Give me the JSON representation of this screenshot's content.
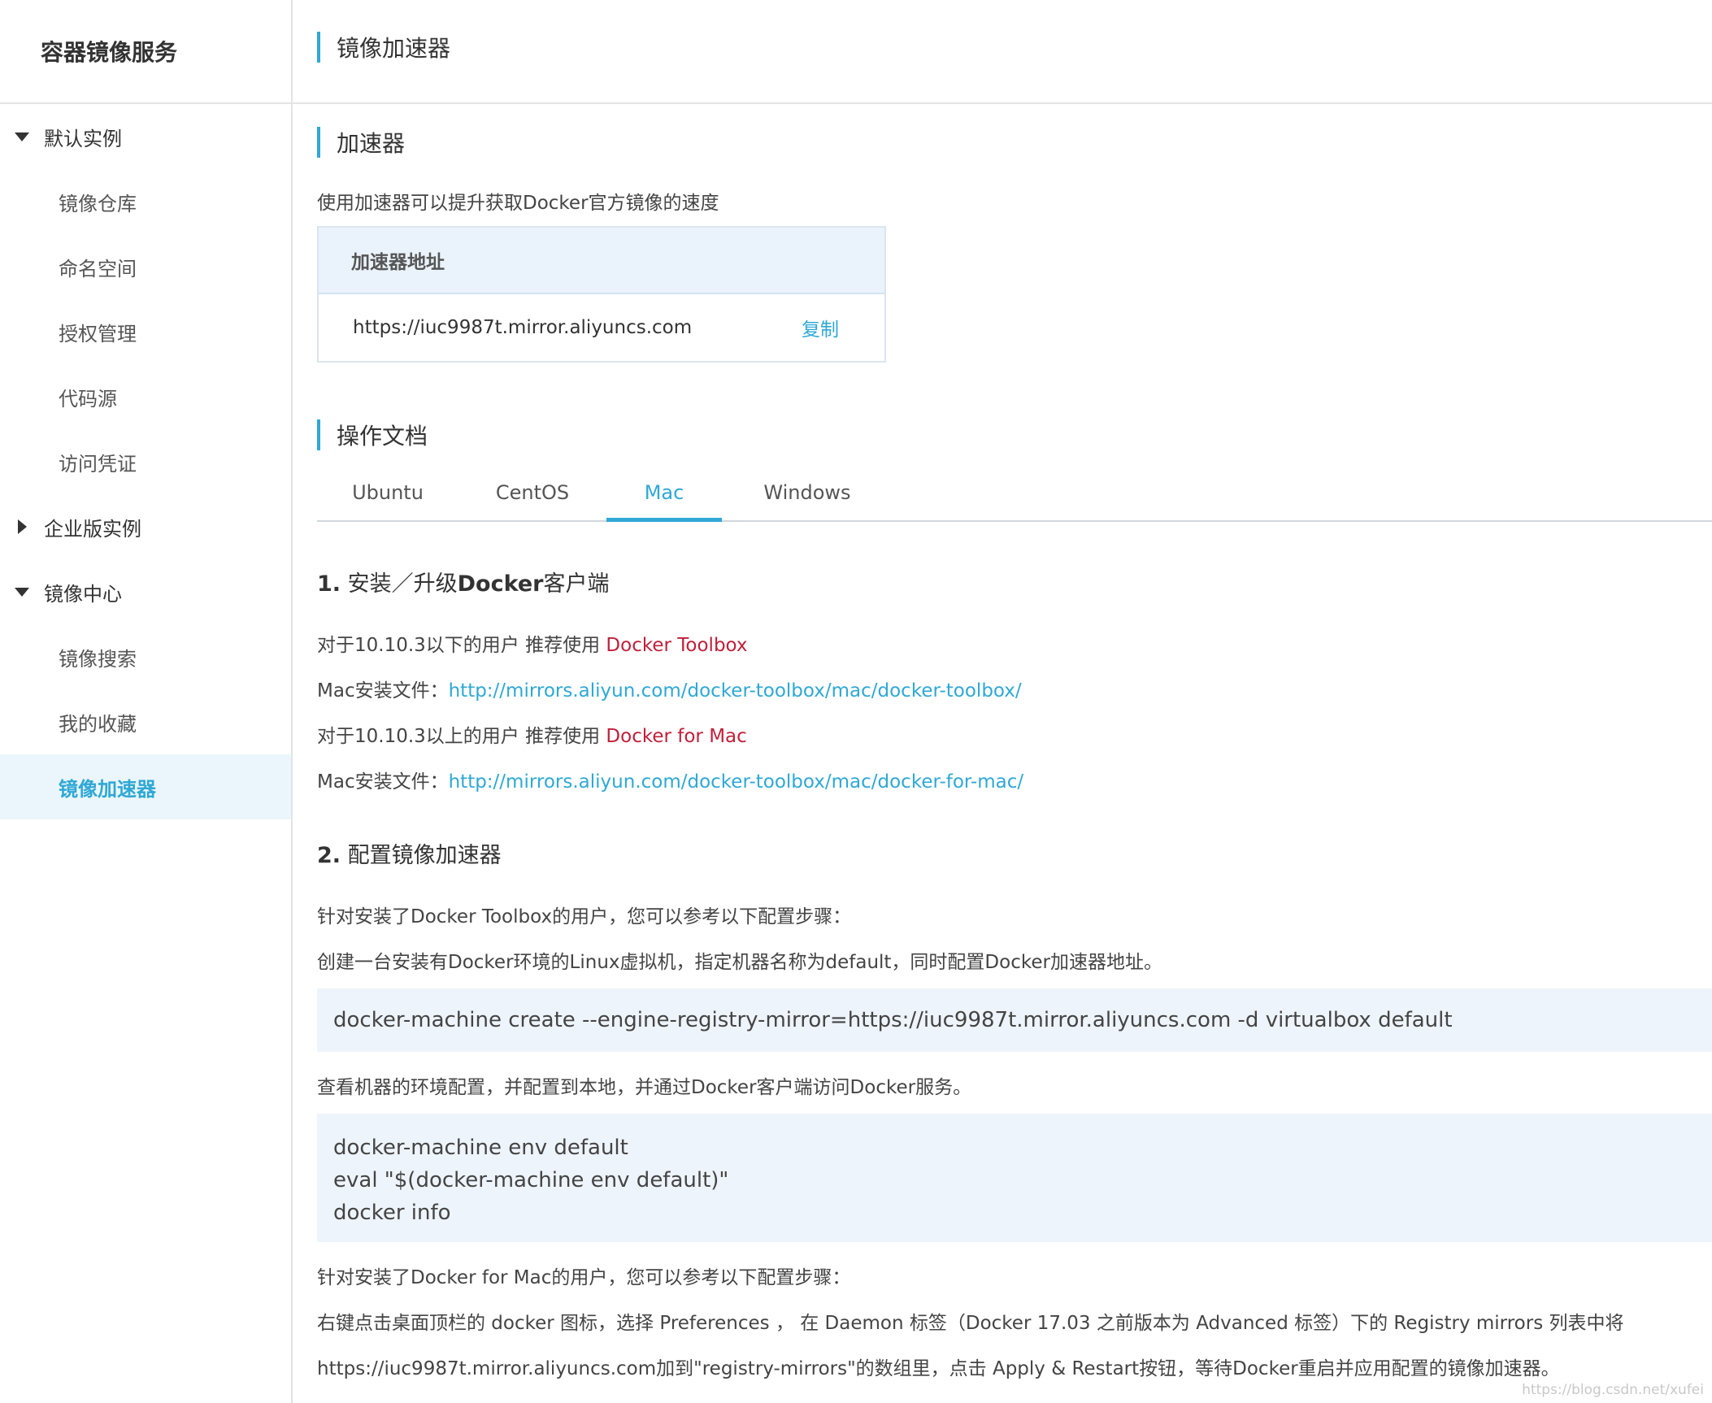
{
  "sidebar": {
    "title": "容器镜像服务",
    "groups": [
      {
        "label": "默认实例",
        "expanded": true,
        "items": [
          "镜像仓库",
          "命名空间",
          "授权管理",
          "代码源",
          "访问凭证"
        ]
      },
      {
        "label": "企业版实例",
        "expanded": false,
        "items": []
      },
      {
        "label": "镜像中心",
        "expanded": true,
        "items": [
          "镜像搜索",
          "我的收藏",
          "镜像加速器"
        ]
      }
    ],
    "active_item": "镜像加速器"
  },
  "header": {
    "title": "镜像加速器"
  },
  "accelerator": {
    "section_title": "加速器",
    "description": "使用加速器可以提升获取Docker官方镜像的速度",
    "table_header": "加速器地址",
    "address": "https://iuc9987t.mirror.aliyuncs.com",
    "copy_label": "复制"
  },
  "docs": {
    "section_title": "操作文档",
    "tabs": [
      "Ubuntu",
      "CentOS",
      "Mac",
      "Windows"
    ],
    "active_tab": "Mac",
    "step1": {
      "num": "1.",
      "title_a": "安装／升级",
      "title_b": "Docker",
      "title_c": "客户端",
      "line1_prefix": "对于10.10.3以下的用户 推荐使用 ",
      "line1_link": "Docker Toolbox",
      "line2_prefix": "Mac安装文件：",
      "line2_link": "http://mirrors.aliyun.com/docker-toolbox/mac/docker-toolbox/",
      "line3_prefix": "对于10.10.3以上的用户 推荐使用 ",
      "line3_link": "Docker for Mac",
      "line4_prefix": "Mac安装文件：",
      "line4_link": "http://mirrors.aliyun.com/docker-toolbox/mac/docker-for-mac/"
    },
    "step2": {
      "num": "2.",
      "title": "配置镜像加速器",
      "p1": "针对安装了Docker Toolbox的用户，您可以参考以下配置步骤：",
      "p2": "创建一台安装有Docker环境的Linux虚拟机，指定机器名称为default，同时配置Docker加速器地址。",
      "code1": "docker-machine create --engine-registry-mirror=https://iuc9987t.mirror.aliyuncs.com -d virtualbox default",
      "p3": "查看机器的环境配置，并配置到本地，并通过Docker客户端访问Docker服务。",
      "code2": [
        "docker-machine env default",
        "eval \"$(docker-machine env default)\"",
        "docker info"
      ],
      "p4": "针对安装了Docker for Mac的用户，您可以参考以下配置步骤：",
      "p5": "右键点击桌面顶栏的 docker 图标，选择 Preferences ， 在 Daemon 标签（Docker 17.03 之前版本为 Advanced 标签）下的 Registry mirrors 列表中将",
      "p6": "https://iuc9987t.mirror.aliyuncs.com加到\"registry-mirrors\"的数组里，点击 Apply & Restart按钮，等待Docker重启并应用配置的镜像加速器。"
    }
  },
  "watermark": "https://blog.csdn.net/xufei"
}
